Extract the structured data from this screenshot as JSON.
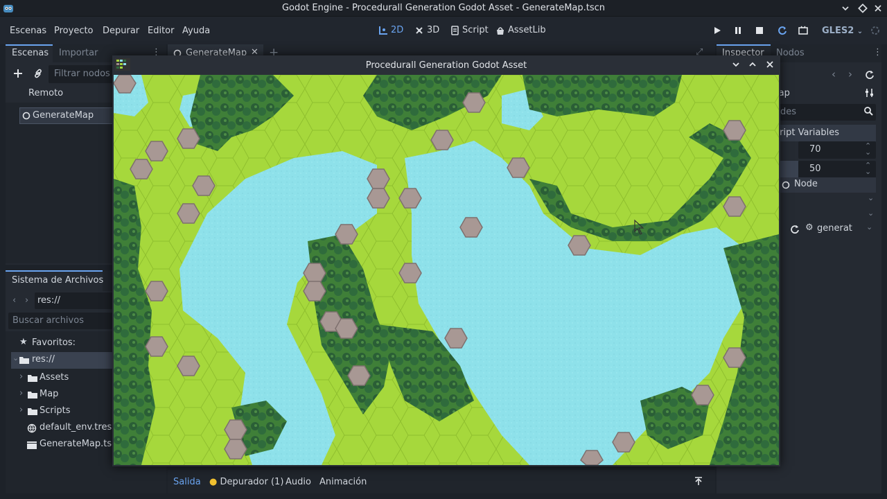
{
  "window": {
    "title": "Godot Engine - Procedurall Generation Godot Asset - GenerateMap.tscn"
  },
  "menu": {
    "items": [
      "Escenas",
      "Proyecto",
      "Depurar",
      "Editor",
      "Ayuda"
    ]
  },
  "workspaces": {
    "w2d": "2D",
    "w3d": "3D",
    "script": "Script",
    "assetlib": "AssetLib"
  },
  "renderer": "GLES2",
  "scene_dock": {
    "tab_scenes": "Escenas",
    "tab_import": "Importar",
    "filter_placeholder": "Filtrar nodos",
    "remote_label": "Remoto",
    "root_node": "GenerateMap"
  },
  "filesystem": {
    "title": "Sistema de Archivos",
    "path": "res://",
    "search_placeholder": "Buscar archivos",
    "favorites": "Favoritos:",
    "root": "res://",
    "items": [
      "Assets",
      "Map",
      "Scripts",
      "default_env.tres",
      "GenerateMap.tscn"
    ]
  },
  "editor_tabs": {
    "scene_tab": "GenerateMap"
  },
  "inspector": {
    "tab_inspector": "Inspector",
    "tab_nodes": "Nodos",
    "object_name": "lap",
    "filter_placeholder": "ades",
    "section": "cript Variables",
    "value1": "70",
    "value2": "50",
    "node_label": "Node",
    "script_name": "generat"
  },
  "bottom_panel": {
    "tabs": [
      "Salida",
      "Depurador (1)",
      "Audio",
      "Animación"
    ]
  },
  "game_window": {
    "title": "Procedurall Generation Godot Asset"
  },
  "colors": {
    "accent": "#6aa4f0",
    "grass": "#a6d83c",
    "water": "#8ee1ea",
    "forest": "#2f6b3c",
    "mountain": "#9e8e8c"
  }
}
